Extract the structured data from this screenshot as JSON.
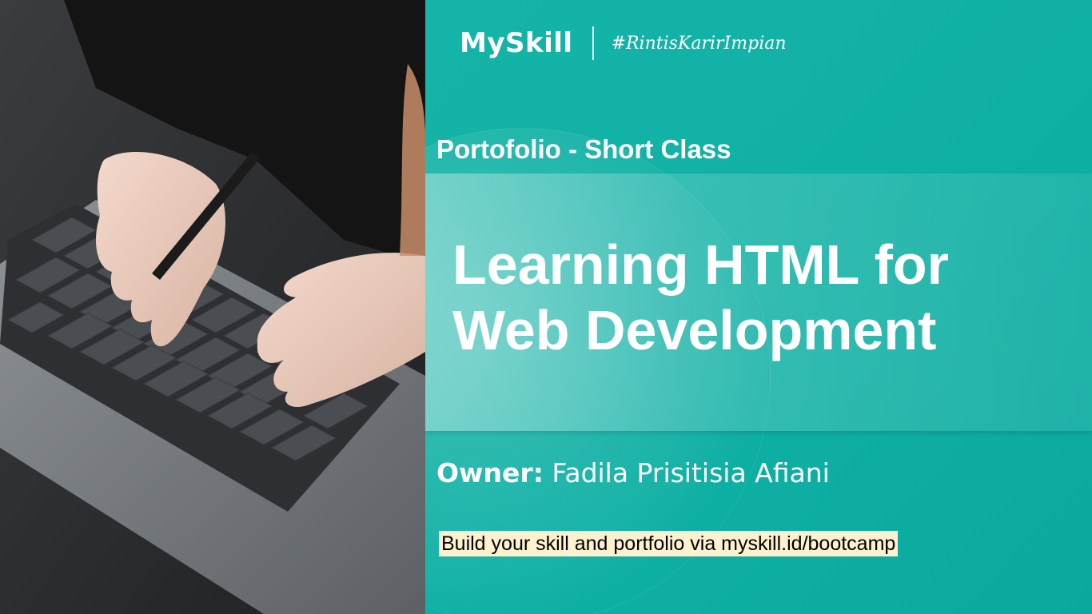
{
  "brand": {
    "logo_text": "MySkill",
    "tagline": "#RintisKarirImpian"
  },
  "slide": {
    "subtitle": "Portofolio - Short Class",
    "title_line1": "Learning HTML for",
    "title_line2": "Web Development",
    "owner_label": "Owner:",
    "owner_name": "Fadila Prisitisia Afiani",
    "cta": "Build your skill and portfolio via myskill.id/bootcamp"
  },
  "colors": {
    "accent_teal": "#0fb0a4",
    "cta_highlight": "#fdf1d0"
  }
}
